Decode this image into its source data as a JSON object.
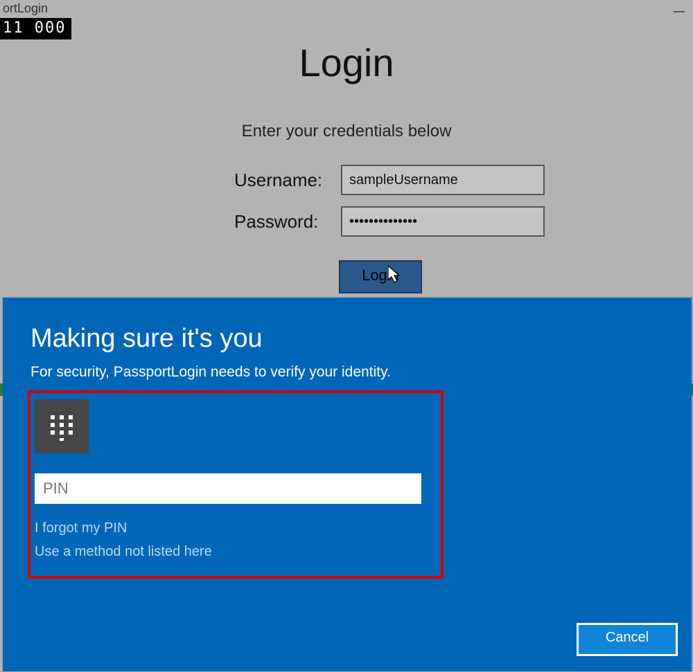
{
  "window": {
    "title_fragment": "ortLogin",
    "counter": "11   000"
  },
  "login": {
    "heading": "Login",
    "subtitle": "Enter your credentials below",
    "username_label": "Username:",
    "username_value": "sampleUsername",
    "password_label": "Password:",
    "password_value": "••••••••••••••",
    "login_button": "Login"
  },
  "hello": {
    "title": "Making sure it's you",
    "subtitle": "For security, PassportLogin needs to verify your identity.",
    "pin_placeholder": "PIN",
    "forgot_link": "I forgot my PIN",
    "other_method_link": "Use a method not listed here",
    "cancel_button": "Cancel"
  }
}
